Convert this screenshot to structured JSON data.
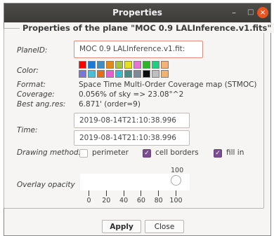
{
  "window": {
    "title": "Properties",
    "minimize": "–",
    "maximize": "□",
    "close": "×"
  },
  "legend": "Properties of the plane \"MOC 0.9 LALInference.v1.fits\"",
  "plane_id": {
    "label": "PlaneID:",
    "value": "MOC 0.9 LALInference.v1.fit:"
  },
  "color": {
    "label": "Color:",
    "row1": [
      "#ff0000",
      "#1d78d4",
      "#3d8fc6",
      "#e38a1f",
      "#a8c53a",
      "#e6e024",
      "#e96fd9",
      "#2fb52c",
      "#1bcf83",
      "#f3b27a"
    ],
    "row2": [
      "#7c74d8",
      "#4abdd8",
      "#e86c12",
      "#e65fd2",
      "#33bcd4",
      "#4c8a86",
      "#7d8a99",
      "#0c0c0c",
      "#bfbfbf",
      "#f1b373"
    ]
  },
  "format": {
    "label": "Format:",
    "value": "Space Time Multi-Order Coverage map (STMOC)"
  },
  "coverage": {
    "label": "Coverage:",
    "value": "0.056% of sky => 23.08°^2"
  },
  "best_res": {
    "label": "Best ang.res:",
    "value": "6.871' (order=9)"
  },
  "time": {
    "label": "Time:",
    "start": "2019-08-14T21:10:38.996",
    "end": "2019-08-14T21:10:38.996"
  },
  "drawing": {
    "label": "Drawing method:",
    "options": [
      {
        "label": "perimeter",
        "checked": false
      },
      {
        "label": "cell borders",
        "checked": true
      },
      {
        "label": "fill in",
        "checked": true
      }
    ]
  },
  "opacity": {
    "label": "Overlay opacity",
    "value": 100,
    "ticks": [
      "0",
      "20",
      "40",
      "60",
      "80",
      "100"
    ]
  },
  "buttons": {
    "apply": "Apply",
    "close": "Close"
  }
}
